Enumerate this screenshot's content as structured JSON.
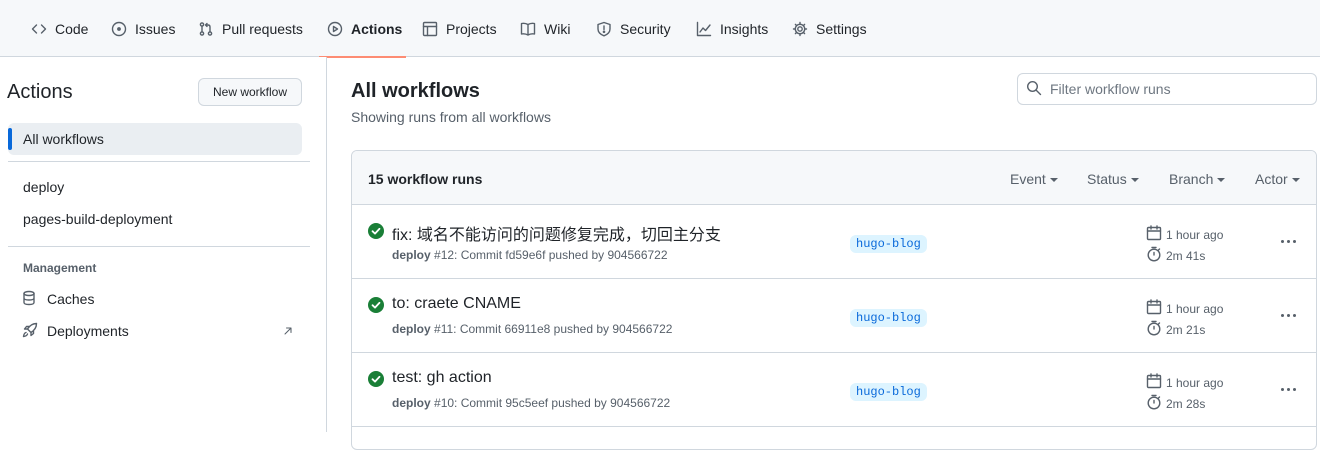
{
  "nav": {
    "tabs": [
      {
        "label": "Code",
        "icon": "code-icon"
      },
      {
        "label": "Issues",
        "icon": "issue-icon"
      },
      {
        "label": "Pull requests",
        "icon": "pull-request-icon"
      },
      {
        "label": "Actions",
        "icon": "play-icon",
        "active": true
      },
      {
        "label": "Projects",
        "icon": "table-icon"
      },
      {
        "label": "Wiki",
        "icon": "book-icon"
      },
      {
        "label": "Security",
        "icon": "shield-icon"
      },
      {
        "label": "Insights",
        "icon": "graph-icon"
      },
      {
        "label": "Settings",
        "icon": "gear-icon"
      }
    ]
  },
  "sidebar": {
    "title": "Actions",
    "new_workflow_label": "New workflow",
    "all_workflows_label": "All workflows",
    "workflows": [
      "deploy",
      "pages-build-deployment"
    ],
    "management_heading": "Management",
    "management_items": [
      {
        "label": "Caches",
        "icon": "database-icon"
      },
      {
        "label": "Deployments",
        "icon": "rocket-icon"
      }
    ]
  },
  "main": {
    "title": "All workflows",
    "subtitle": "Showing runs from all workflows",
    "filter_placeholder": "Filter workflow runs",
    "runs_count": "15 workflow runs",
    "filters": [
      "Event",
      "Status",
      "Branch",
      "Actor"
    ],
    "runs": [
      {
        "title": "fix: 域名不能访问的问题修复完成，切回主分支",
        "workflow": "deploy",
        "meta": "#12: Commit fd59e6f pushed by 904566722",
        "branch": "hugo-blog",
        "when": "1 hour ago",
        "duration": "2m 41s"
      },
      {
        "title": "to: craete CNAME",
        "workflow": "deploy",
        "meta": "#11: Commit 66911e8 pushed by 904566722",
        "branch": "hugo-blog",
        "when": "1 hour ago",
        "duration": "2m 21s"
      },
      {
        "title": "test: gh action",
        "workflow": "deploy",
        "meta": "#10: Commit 95c5eef pushed by 904566722",
        "branch": "hugo-blog",
        "when": "1 hour ago",
        "duration": "2m 28s"
      }
    ]
  },
  "colors": {
    "accent": "#0969da",
    "success": "#1a7f37",
    "active_tab_underline": "#fd8c73"
  }
}
